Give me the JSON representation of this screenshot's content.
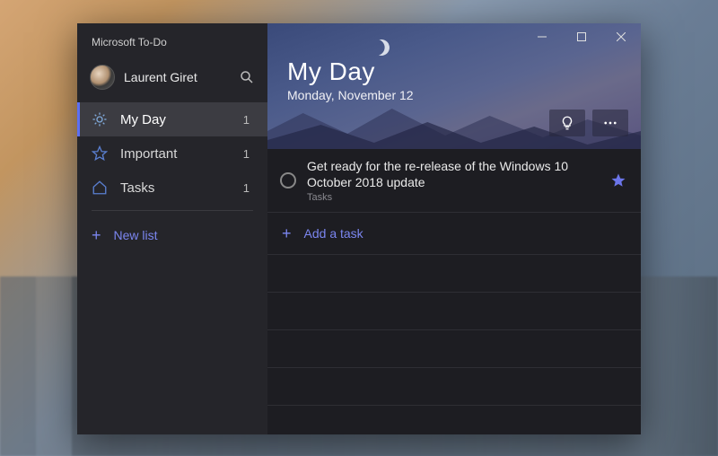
{
  "app": {
    "title": "Microsoft To-Do"
  },
  "user": {
    "name": "Laurent Giret"
  },
  "sidebar": {
    "items": [
      {
        "label": "My Day",
        "count": "1",
        "icon": "sun",
        "active": true
      },
      {
        "label": "Important",
        "count": "1",
        "icon": "star",
        "active": false
      },
      {
        "label": "Tasks",
        "count": "1",
        "icon": "home",
        "active": false
      }
    ],
    "new_list_label": "New list"
  },
  "header": {
    "title": "My Day",
    "date": "Monday, November 12"
  },
  "tasks": [
    {
      "title": "Get ready for the re-release of the Windows 10 October 2018 update",
      "list": "Tasks",
      "starred": true,
      "completed": false
    }
  ],
  "add_task_label": "Add a task",
  "colors": {
    "accent": "#7b86f0"
  }
}
